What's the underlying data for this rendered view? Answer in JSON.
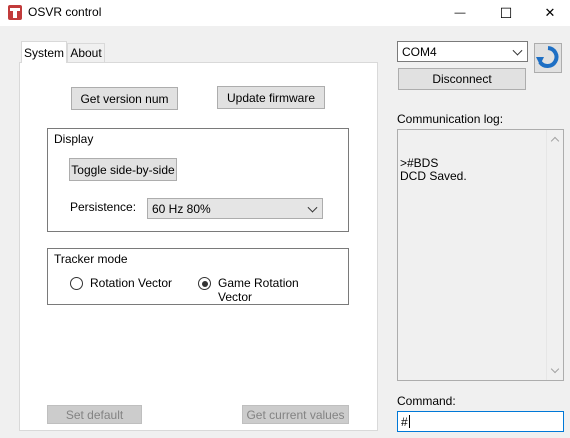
{
  "window": {
    "title": "OSVR control",
    "minimize_glyph": "—",
    "maximize_glyph": "☐",
    "close_glyph": "✕"
  },
  "tabs": [
    {
      "label": "System",
      "active": true
    },
    {
      "label": "About",
      "active": false
    }
  ],
  "system": {
    "get_version_label": "Get version num",
    "update_firmware_label": "Update firmware",
    "display_group_label": "Display",
    "toggle_sbs_label": "Toggle side-by-side",
    "persistence_label": "Persistence:",
    "persistence_value": "60 Hz 80%",
    "tracker_group_label": "Tracker mode",
    "radio_rotation_label": "Rotation Vector",
    "radio_game_rotation_label": "Game Rotation Vector",
    "selected_tracker_mode": "Game Rotation Vector",
    "set_default_label": "Set default",
    "get_current_values_label": "Get current values"
  },
  "connection": {
    "port_value": "COM4",
    "disconnect_label": "Disconnect",
    "log_label": "Communication log:",
    "log_text": ">#BDS\nDCD Saved.",
    "command_label": "Command:",
    "command_value": "#"
  },
  "icons": {
    "app": "osvr-logo-icon",
    "refresh": "refresh-icon"
  },
  "colors": {
    "accent": "#0078d7",
    "app_icon": "#c23b3b",
    "refresh_icon": "#1e6fc4"
  }
}
